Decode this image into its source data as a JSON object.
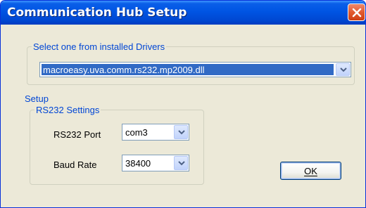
{
  "window": {
    "title": "Communication Hub Setup",
    "close_icon": "close-icon"
  },
  "drivers": {
    "group_label": "Select one from installed Drivers",
    "selected": "macroeasy.uva.comm.rs232.mp2009.dll"
  },
  "setup": {
    "label": "Setup",
    "rs232_group_label": "RS232 Settings",
    "port_label": "RS232 Port",
    "port_value": "com3",
    "baud_label": "Baud Rate",
    "baud_value": "38400"
  },
  "buttons": {
    "ok_label": "OK"
  },
  "colors": {
    "titlebar": "#0054e3",
    "group_label": "#0046d5",
    "selection": "#316ac5",
    "window_bg": "#ece9d8"
  }
}
